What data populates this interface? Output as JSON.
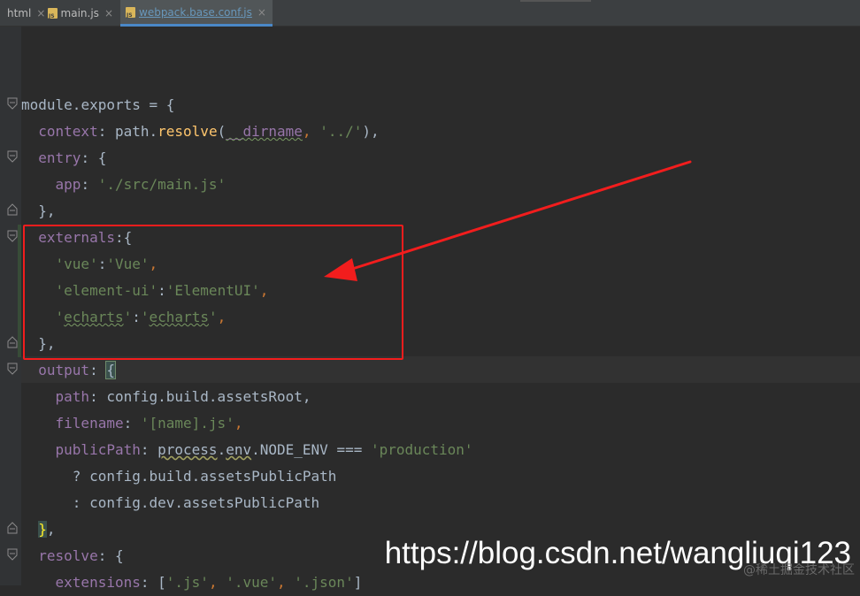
{
  "tabs": [
    {
      "label": "html",
      "icon": "html-file-icon",
      "active": false
    },
    {
      "label": "main.js",
      "icon": "js-file-icon",
      "active": false
    },
    {
      "label": "webpack.base.conf.js",
      "icon": "js-file-icon",
      "active": true
    }
  ],
  "close_glyph": "×",
  "code": {
    "l1": {
      "a": "module",
      "b": ".",
      "c": "exports",
      "d": " = {"
    },
    "l2": {
      "a": "context",
      "b": ": path.",
      "c": "resolve",
      "d": "(",
      "e": "__dirname",
      "f": ", ",
      "g": "'../'",
      "h": "),"
    },
    "l3": {
      "a": "entry",
      "b": ": {"
    },
    "l4": {
      "a": "app",
      "b": ": ",
      "c": "'./src/main.js'"
    },
    "l5": {
      "a": "},"
    },
    "l6": {
      "a": "externals",
      "b": ":{"
    },
    "l7": {
      "a": "'vue'",
      "b": ":",
      "c": "'Vue'",
      "d": ","
    },
    "l8": {
      "a": "'element-ui'",
      "b": ":",
      "c": "'ElementUI'",
      "d": ","
    },
    "l9": {
      "a": "'",
      "b": "echarts",
      "c": "'",
      "d": ":",
      "e": "'",
      "f": "echarts",
      "g": "'",
      "h": ","
    },
    "l10": {
      "a": "},"
    },
    "l11": {
      "a": "output",
      "b": ": ",
      "c": "{"
    },
    "l12": {
      "a": "path",
      "b": ": config.build.assetsRoot,"
    },
    "l13": {
      "a": "filename",
      "b": ": ",
      "c": "'[name].js'",
      "d": ","
    },
    "l14": {
      "a": "publicPath",
      "b": ": ",
      "c": "process",
      "d": ".",
      "e": "env",
      "f": ".NODE_ENV === ",
      "g": "'production'"
    },
    "l15": {
      "a": "? config.build.assetsPublicPath"
    },
    "l16": {
      "a": ": config.dev.assetsPublicPath"
    },
    "l17": {
      "a": "}",
      "b": ","
    },
    "l18": {
      "a": "resolve",
      "b": ": {"
    },
    "l19": {
      "a": "extensions",
      "b": ": [",
      "c": "'.js'",
      "d": ", ",
      "e": "'.vue'",
      "f": ", ",
      "g": "'.json'",
      "h": "]"
    }
  },
  "watermark": "https://blog.csdn.net/wangliuqi123",
  "watermark_faint": "@稀土掘金技术社区",
  "colors": {
    "keyword": "#cc7832",
    "property": "#9876aa",
    "string": "#6a8759",
    "function": "#ffc66d",
    "annotation_red": "#f21d1d"
  }
}
